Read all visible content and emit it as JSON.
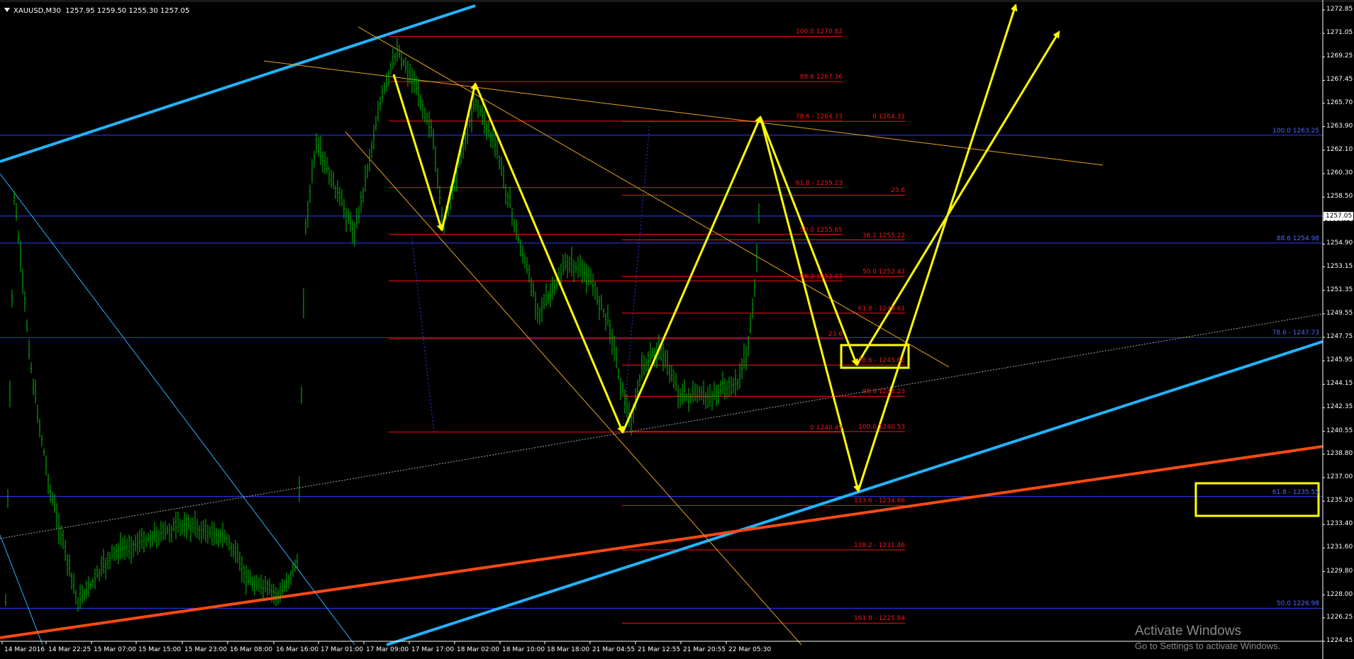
{
  "window": {
    "symbol": "XAUUSD,M30",
    "ohlc": "1257.95 1259.50 1255.30 1257.05",
    "current_price": "1257.05"
  },
  "colors": {
    "background": "#000000",
    "candles": "#00c000",
    "fib_levels": "#ff1010",
    "horizontal_levels": "#2a3cff",
    "channel": "#23b4ff",
    "support": "#ff4a12",
    "trendline": "#e8a317",
    "pattern": "#ffff00"
  },
  "price_axis": {
    "min": 1224.45,
    "max": 1272.85,
    "ticks": [
      "1272.85",
      "1271.05",
      "1269.25",
      "1267.45",
      "1265.70",
      "1263.90",
      "1262.10",
      "1260.30",
      "1258.50",
      "1256.70",
      "1254.90",
      "1253.15",
      "1251.35",
      "1249.55",
      "1247.75",
      "1245.95",
      "1244.15",
      "1242.35",
      "1240.55",
      "1238.80",
      "1237.00",
      "1235.20",
      "1233.40",
      "1231.60",
      "1229.80",
      "1228.00",
      "1226.25",
      "1224.45"
    ]
  },
  "time_axis": {
    "labels": [
      "14 Mar 2016",
      "14 Mar 22:25",
      "15 Mar 07:00",
      "15 Mar 15:00",
      "15 Mar 23:00",
      "16 Mar 08:00",
      "16 Mar 16:00",
      "17 Mar 01:00",
      "17 Mar 09:00",
      "17 Mar 17:00",
      "18 Mar 02:00",
      "18 Mar 10:00",
      "18 Mar 18:00",
      "21 Mar 04:55",
      "21 Mar 12:55",
      "21 Mar 20:55",
      "22 Mar 05:30"
    ]
  },
  "horizontal_levels": [
    {
      "label": "100.0 1263.25",
      "price": 1263.25
    },
    {
      "label": "88.6 1254.98",
      "price": 1254.98
    },
    {
      "label": "78.6 - 1247.73",
      "price": 1247.73
    },
    {
      "label": "61.8 - 1235.55",
      "price": 1235.55
    },
    {
      "label": "50.0 1226.98",
      "price": 1226.98
    }
  ],
  "fib_left": [
    {
      "label": "100.0 1270.82",
      "price": 1270.82
    },
    {
      "label": "88.6 1267.36",
      "price": 1267.36
    },
    {
      "label": "78.6 - 1264.33",
      "price": 1264.33
    },
    {
      "label": "61.8 - 1259.23",
      "price": 1259.23
    },
    {
      "label": "50.0 1255.65",
      "price": 1255.65
    },
    {
      "label": "38.2 1252.07",
      "price": 1252.07
    },
    {
      "label": "23.6",
      "price": 1247.64
    },
    {
      "label": "0 1240.49",
      "price": 1240.49
    }
  ],
  "fib_right": [
    {
      "label": "0 1264.31",
      "price": 1264.31
    },
    {
      "label": "23.6",
      "price": 1258.65
    },
    {
      "label": "38.2 1255.22",
      "price": 1255.22
    },
    {
      "label": "50.0 1252.42",
      "price": 1252.42
    },
    {
      "label": "61.8 - 1249.61",
      "price": 1249.61
    },
    {
      "label": "78.6 - 1245.62",
      "price": 1245.62
    },
    {
      "label": "88.6 1243.23",
      "price": 1243.23
    },
    {
      "label": "100.0 1240.53",
      "price": 1240.53
    },
    {
      "label": "123.6 - 1234.86",
      "price": 1234.86
    },
    {
      "label": "138.2 - 1231.46",
      "price": 1231.46
    },
    {
      "label": "161.8 - 1225.84",
      "price": 1225.84
    }
  ],
  "watermark": {
    "title": "Activate Windows",
    "subtitle": "Go to Settings to activate Windows."
  }
}
